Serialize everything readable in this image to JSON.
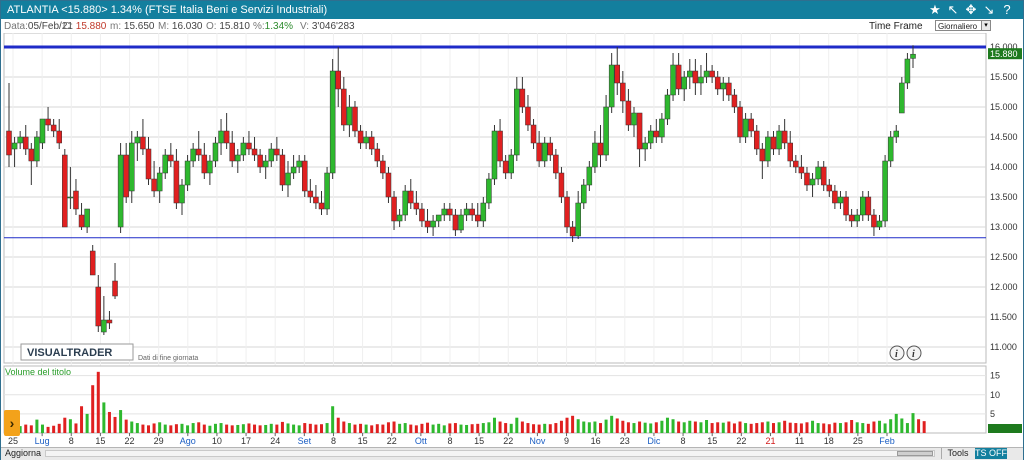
{
  "title": {
    "text": "ATLANTIA <15.880> 1.34%  (FTSE Italia Beni e Servizi Industriali)",
    "icons": [
      "star-icon",
      "arrow-icon",
      "move-icon",
      "collapse-icon",
      "help-icon"
    ]
  },
  "info": {
    "data_label": "Data:",
    "data_value": "05/Feb/21",
    "c_label": "C:",
    "c_value": "15.880",
    "m_label": "m:",
    "m_value": "15.650",
    "M_label": "M:",
    "M_value": "16.030",
    "o_label": "O:",
    "o_value": "15.810",
    "pct_label": "%:",
    "pct_value": "1.34%",
    "v_label": "V:",
    "v_value": "3'046'283"
  },
  "timeframe": {
    "label": "Time Frame",
    "value": "Giornaliero"
  },
  "brand": {
    "logo": "VISUALTRADER",
    "note": "Dati di fine giornata"
  },
  "bottombar": {
    "aggiorna": "Aggiorna",
    "tools": "Tools",
    "tsoff": "TS OFF"
  },
  "colors": {
    "up": "#2eb82e",
    "down": "#e02020",
    "hline": "#1f2bc8",
    "titlebar": "#137f9e",
    "last_price_bg": "#1e7a1e"
  },
  "chart_data": {
    "type": "candlestick",
    "ylim": [
      10.8,
      16.1
    ],
    "y_ticks": [
      "16.000",
      "15.500",
      "15.000",
      "14.500",
      "14.000",
      "13.500",
      "13.000",
      "12.500",
      "12.000",
      "11.500",
      "11.000"
    ],
    "x_ticks": [
      "25",
      "Lug",
      "8",
      "15",
      "22",
      "29",
      "Ago",
      "10",
      "17",
      "24",
      "Set",
      "8",
      "15",
      "22",
      "Ott",
      "8",
      "15",
      "22",
      "Nov",
      "9",
      "16",
      "23",
      "Dic",
      "8",
      "15",
      "22",
      "21",
      "11",
      "18",
      "25",
      "Feb"
    ],
    "red_ticks": [
      "21"
    ],
    "last_price": "15.880",
    "hlines": [
      16.0,
      12.82
    ],
    "ohlc": [
      [
        14.6,
        15.4,
        14.0,
        14.2
      ],
      [
        14.3,
        14.5,
        14.0,
        14.4
      ],
      [
        14.4,
        14.6,
        14.3,
        14.5
      ],
      [
        14.5,
        14.7,
        14.2,
        14.3
      ],
      [
        14.3,
        14.4,
        13.7,
        14.1
      ],
      [
        14.1,
        14.6,
        14.0,
        14.5
      ],
      [
        14.4,
        14.8,
        14.3,
        14.8
      ],
      [
        14.8,
        15.0,
        14.6,
        14.7
      ],
      [
        14.7,
        14.8,
        14.5,
        14.6
      ],
      [
        14.6,
        14.8,
        14.3,
        14.4
      ],
      [
        14.2,
        14.3,
        13.0,
        13.0
      ],
      [
        13.5,
        14.0,
        13.3,
        13.5
      ],
      [
        13.6,
        13.8,
        13.2,
        13.3
      ],
      [
        13.2,
        13.4,
        12.95,
        13.0
      ],
      [
        13.0,
        13.3,
        12.9,
        13.3
      ],
      [
        12.6,
        12.7,
        12.2,
        12.2
      ],
      [
        12.0,
        12.2,
        11.25,
        11.35
      ],
      [
        11.25,
        11.85,
        11.2,
        11.45
      ],
      [
        11.45,
        11.6,
        11.3,
        11.4
      ],
      [
        12.1,
        12.4,
        11.8,
        11.85
      ],
      [
        13.0,
        14.4,
        12.9,
        14.2
      ],
      [
        14.2,
        14.4,
        13.4,
        13.5
      ],
      [
        13.6,
        14.6,
        13.4,
        14.4
      ],
      [
        14.4,
        14.6,
        14.1,
        14.5
      ],
      [
        14.5,
        14.8,
        14.2,
        14.3
      ],
      [
        14.3,
        14.5,
        13.7,
        13.8
      ],
      [
        13.8,
        14.1,
        13.5,
        13.6
      ],
      [
        13.6,
        14.0,
        13.4,
        13.9
      ],
      [
        13.9,
        14.3,
        13.8,
        14.2
      ],
      [
        14.2,
        14.4,
        14.0,
        14.1
      ],
      [
        14.1,
        14.3,
        13.3,
        13.4
      ],
      [
        13.4,
        13.8,
        13.2,
        13.7
      ],
      [
        13.7,
        14.2,
        13.6,
        14.1
      ],
      [
        14.1,
        14.4,
        14.0,
        14.3
      ],
      [
        14.3,
        14.6,
        14.1,
        14.2
      ],
      [
        14.2,
        14.4,
        13.8,
        13.9
      ],
      [
        13.9,
        14.2,
        13.7,
        14.1
      ],
      [
        14.1,
        14.5,
        14.0,
        14.4
      ],
      [
        14.4,
        14.8,
        14.2,
        14.6
      ],
      [
        14.6,
        14.9,
        14.3,
        14.4
      ],
      [
        14.4,
        14.6,
        14.0,
        14.1
      ],
      [
        14.1,
        14.3,
        13.9,
        14.2
      ],
      [
        14.2,
        14.5,
        14.1,
        14.4
      ],
      [
        14.4,
        14.6,
        14.2,
        14.3
      ],
      [
        14.3,
        14.5,
        14.1,
        14.2
      ],
      [
        14.2,
        14.3,
        13.9,
        14.0
      ],
      [
        14.0,
        14.2,
        13.8,
        14.1
      ],
      [
        14.1,
        14.4,
        14.0,
        14.3
      ],
      [
        14.3,
        14.5,
        14.1,
        14.2
      ],
      [
        14.2,
        14.3,
        13.6,
        13.7
      ],
      [
        13.7,
        14.1,
        13.5,
        13.9
      ],
      [
        13.9,
        14.2,
        13.8,
        14.0
      ],
      [
        14.0,
        14.2,
        13.9,
        14.1
      ],
      [
        14.1,
        14.2,
        13.5,
        13.6
      ],
      [
        13.6,
        13.8,
        13.4,
        13.5
      ],
      [
        13.5,
        13.7,
        13.3,
        13.4
      ],
      [
        13.4,
        13.6,
        13.2,
        13.3
      ],
      [
        13.3,
        14.0,
        13.2,
        13.9
      ],
      [
        13.9,
        15.8,
        13.8,
        15.6
      ],
      [
        15.6,
        16.0,
        15.0,
        15.3
      ],
      [
        15.3,
        15.5,
        14.6,
        14.7
      ],
      [
        14.7,
        15.2,
        14.5,
        15.0
      ],
      [
        15.0,
        15.1,
        14.5,
        14.6
      ],
      [
        14.6,
        14.7,
        14.3,
        14.4
      ],
      [
        14.4,
        14.6,
        14.3,
        14.5
      ],
      [
        14.5,
        14.6,
        14.2,
        14.3
      ],
      [
        14.3,
        14.4,
        14.0,
        14.1
      ],
      [
        14.1,
        14.2,
        13.8,
        13.9
      ],
      [
        13.9,
        14.0,
        13.4,
        13.5
      ],
      [
        13.5,
        13.6,
        12.95,
        13.1
      ],
      [
        13.1,
        13.3,
        13.0,
        13.2
      ],
      [
        13.2,
        13.7,
        13.1,
        13.6
      ],
      [
        13.6,
        13.8,
        13.3,
        13.4
      ],
      [
        13.4,
        13.6,
        13.2,
        13.3
      ],
      [
        13.3,
        13.4,
        13.0,
        13.1
      ],
      [
        13.1,
        13.3,
        12.9,
        13.0
      ],
      [
        13.0,
        13.2,
        12.85,
        13.1
      ],
      [
        13.1,
        13.2,
        13.0,
        13.2
      ],
      [
        13.2,
        13.4,
        13.1,
        13.3
      ],
      [
        13.3,
        13.4,
        13.1,
        13.2
      ],
      [
        13.2,
        13.3,
        12.85,
        12.95
      ],
      [
        12.95,
        13.3,
        12.9,
        13.2
      ],
      [
        13.2,
        13.4,
        13.1,
        13.3
      ],
      [
        13.3,
        13.4,
        13.1,
        13.2
      ],
      [
        13.2,
        13.4,
        13.0,
        13.1
      ],
      [
        13.1,
        13.5,
        13.0,
        13.4
      ],
      [
        13.4,
        13.9,
        13.3,
        13.8
      ],
      [
        13.8,
        14.7,
        13.7,
        14.6
      ],
      [
        14.6,
        14.8,
        14.0,
        14.1
      ],
      [
        14.1,
        14.2,
        13.8,
        13.9
      ],
      [
        13.9,
        14.3,
        13.8,
        14.2
      ],
      [
        14.2,
        15.5,
        14.1,
        15.3
      ],
      [
        15.3,
        15.5,
        14.9,
        15.0
      ],
      [
        15.0,
        15.2,
        14.6,
        14.7
      ],
      [
        14.7,
        14.8,
        14.3,
        14.4
      ],
      [
        14.4,
        14.6,
        14.0,
        14.1
      ],
      [
        14.1,
        14.5,
        14.0,
        14.4
      ],
      [
        14.4,
        14.5,
        14.1,
        14.2
      ],
      [
        14.2,
        14.3,
        13.8,
        13.9
      ],
      [
        13.9,
        14.0,
        13.4,
        13.5
      ],
      [
        13.5,
        13.6,
        12.9,
        13.0
      ],
      [
        13.0,
        13.1,
        12.75,
        12.85
      ],
      [
        12.85,
        13.6,
        12.8,
        13.4
      ],
      [
        13.4,
        13.8,
        13.3,
        13.7
      ],
      [
        13.7,
        14.1,
        13.6,
        14.0
      ],
      [
        14.0,
        14.6,
        13.9,
        14.4
      ],
      [
        14.4,
        14.7,
        14.0,
        14.2
      ],
      [
        14.2,
        15.2,
        14.1,
        15.0
      ],
      [
        15.0,
        15.9,
        14.9,
        15.7
      ],
      [
        15.7,
        16.0,
        15.2,
        15.4
      ],
      [
        15.4,
        15.6,
        14.9,
        15.1
      ],
      [
        15.1,
        15.3,
        14.6,
        14.7
      ],
      [
        14.7,
        15.0,
        14.5,
        14.9
      ],
      [
        14.9,
        14.9,
        14.0,
        14.3
      ],
      [
        14.3,
        14.5,
        14.1,
        14.4
      ],
      [
        14.4,
        14.7,
        14.3,
        14.6
      ],
      [
        14.6,
        14.8,
        14.4,
        14.5
      ],
      [
        14.5,
        14.9,
        14.4,
        14.8
      ],
      [
        14.8,
        15.3,
        14.7,
        15.2
      ],
      [
        15.2,
        15.9,
        15.1,
        15.7
      ],
      [
        15.7,
        15.9,
        15.2,
        15.3
      ],
      [
        15.3,
        15.6,
        15.1,
        15.5
      ],
      [
        15.5,
        15.8,
        15.3,
        15.6
      ],
      [
        15.6,
        15.8,
        15.2,
        15.4
      ],
      [
        15.4,
        15.7,
        15.2,
        15.5
      ],
      [
        15.5,
        15.9,
        15.4,
        15.6
      ],
      [
        15.6,
        15.7,
        15.4,
        15.5
      ],
      [
        15.5,
        15.6,
        15.2,
        15.3
      ],
      [
        15.3,
        15.5,
        15.1,
        15.4
      ],
      [
        15.4,
        15.5,
        15.1,
        15.2
      ],
      [
        15.2,
        15.3,
        14.9,
        15.0
      ],
      [
        15.0,
        15.1,
        14.4,
        14.5
      ],
      [
        14.5,
        14.9,
        14.4,
        14.8
      ],
      [
        14.8,
        14.9,
        14.5,
        14.6
      ],
      [
        14.6,
        14.7,
        14.2,
        14.3
      ],
      [
        14.3,
        14.4,
        13.8,
        14.1
      ],
      [
        14.1,
        14.6,
        14.0,
        14.5
      ],
      [
        14.5,
        14.6,
        14.2,
        14.3
      ],
      [
        14.3,
        14.7,
        14.2,
        14.6
      ],
      [
        14.6,
        14.8,
        14.3,
        14.4
      ],
      [
        14.4,
        14.6,
        14.0,
        14.1
      ],
      [
        14.1,
        14.2,
        13.9,
        14.0
      ],
      [
        14.0,
        14.2,
        13.8,
        13.9
      ],
      [
        13.9,
        14.0,
        13.6,
        13.7
      ],
      [
        13.7,
        13.9,
        13.5,
        13.8
      ],
      [
        13.8,
        14.1,
        13.7,
        14.0
      ],
      [
        14.0,
        14.1,
        13.6,
        13.7
      ],
      [
        13.7,
        13.8,
        13.5,
        13.6
      ],
      [
        13.6,
        13.7,
        13.3,
        13.4
      ],
      [
        13.4,
        13.6,
        13.3,
        13.5
      ],
      [
        13.5,
        13.6,
        13.1,
        13.2
      ],
      [
        13.2,
        13.3,
        13.0,
        13.1
      ],
      [
        13.1,
        13.3,
        13.0,
        13.2
      ],
      [
        13.2,
        13.6,
        13.1,
        13.5
      ],
      [
        13.5,
        13.6,
        13.1,
        13.2
      ],
      [
        13.2,
        13.3,
        12.85,
        13.0
      ],
      [
        13.0,
        13.2,
        12.95,
        13.1
      ],
      [
        13.1,
        14.2,
        13.0,
        14.1
      ],
      [
        14.1,
        14.6,
        14.0,
        14.5
      ],
      [
        14.5,
        14.7,
        14.4,
        14.6
      ],
      [
        14.9,
        15.5,
        14.9,
        15.4
      ],
      [
        15.4,
        15.9,
        15.3,
        15.8
      ],
      [
        15.81,
        16.03,
        15.65,
        15.88
      ]
    ],
    "volume": {
      "label": "Volume del titolo",
      "ylim": [
        0,
        17
      ],
      "y_ticks": [
        "15",
        "10",
        "5"
      ],
      "values": [
        2.5,
        3.2,
        1.8,
        2.2,
        2.0,
        3.5,
        2.2,
        1.6,
        1.9,
        2.4,
        4.0,
        3.6,
        2.5,
        7.0,
        5.0,
        12.5,
        16.0,
        8.0,
        5.5,
        4.2,
        6.0,
        3.5,
        3.0,
        2.6,
        2.2,
        2.0,
        2.5,
        2.8,
        2.2,
        2.0,
        2.3,
        2.4,
        2.0,
        2.6,
        2.8,
        2.2,
        1.9,
        2.4,
        2.6,
        2.2,
        2.0,
        2.1,
        2.3,
        2.5,
        2.2,
        2.0,
        2.1,
        2.4,
        2.2,
        2.9,
        2.5,
        2.2,
        2.0,
        2.6,
        2.4,
        2.2,
        2.3,
        2.6,
        7.0,
        4.0,
        3.0,
        2.6,
        2.2,
        2.4,
        2.2,
        2.0,
        2.3,
        2.2,
        2.8,
        3.0,
        2.4,
        2.6,
        2.2,
        2.0,
        2.4,
        2.7,
        2.2,
        2.4,
        2.0,
        2.5,
        2.6,
        2.2,
        2.1,
        2.3,
        2.4,
        2.6,
        2.8,
        4.0,
        3.0,
        2.6,
        2.4,
        4.0,
        3.0,
        2.6,
        2.3,
        2.2,
        2.4,
        2.3,
        2.6,
        3.2,
        4.0,
        4.5,
        3.6,
        3.0,
        2.8,
        3.0,
        2.6,
        3.5,
        4.5,
        3.8,
        3.2,
        2.8,
        2.6,
        3.0,
        2.7,
        2.5,
        2.8,
        3.2,
        4.0,
        3.6,
        3.0,
        2.8,
        3.2,
        3.0,
        2.8,
        3.4,
        2.6,
        2.8,
        2.7,
        3.0,
        2.5,
        3.0,
        2.6,
        2.4,
        2.6,
        2.8,
        3.0,
        2.6,
        2.8,
        3.2,
        2.7,
        2.6,
        2.5,
        2.8,
        3.2,
        2.6,
        2.5,
        2.3,
        2.7,
        2.6,
        2.8,
        3.4,
        2.8,
        2.6,
        2.4,
        3.0,
        3.2,
        2.5,
        3.6,
        5.0,
        3.8,
        2.6,
        5.2,
        3.6,
        3.1
      ]
    }
  }
}
